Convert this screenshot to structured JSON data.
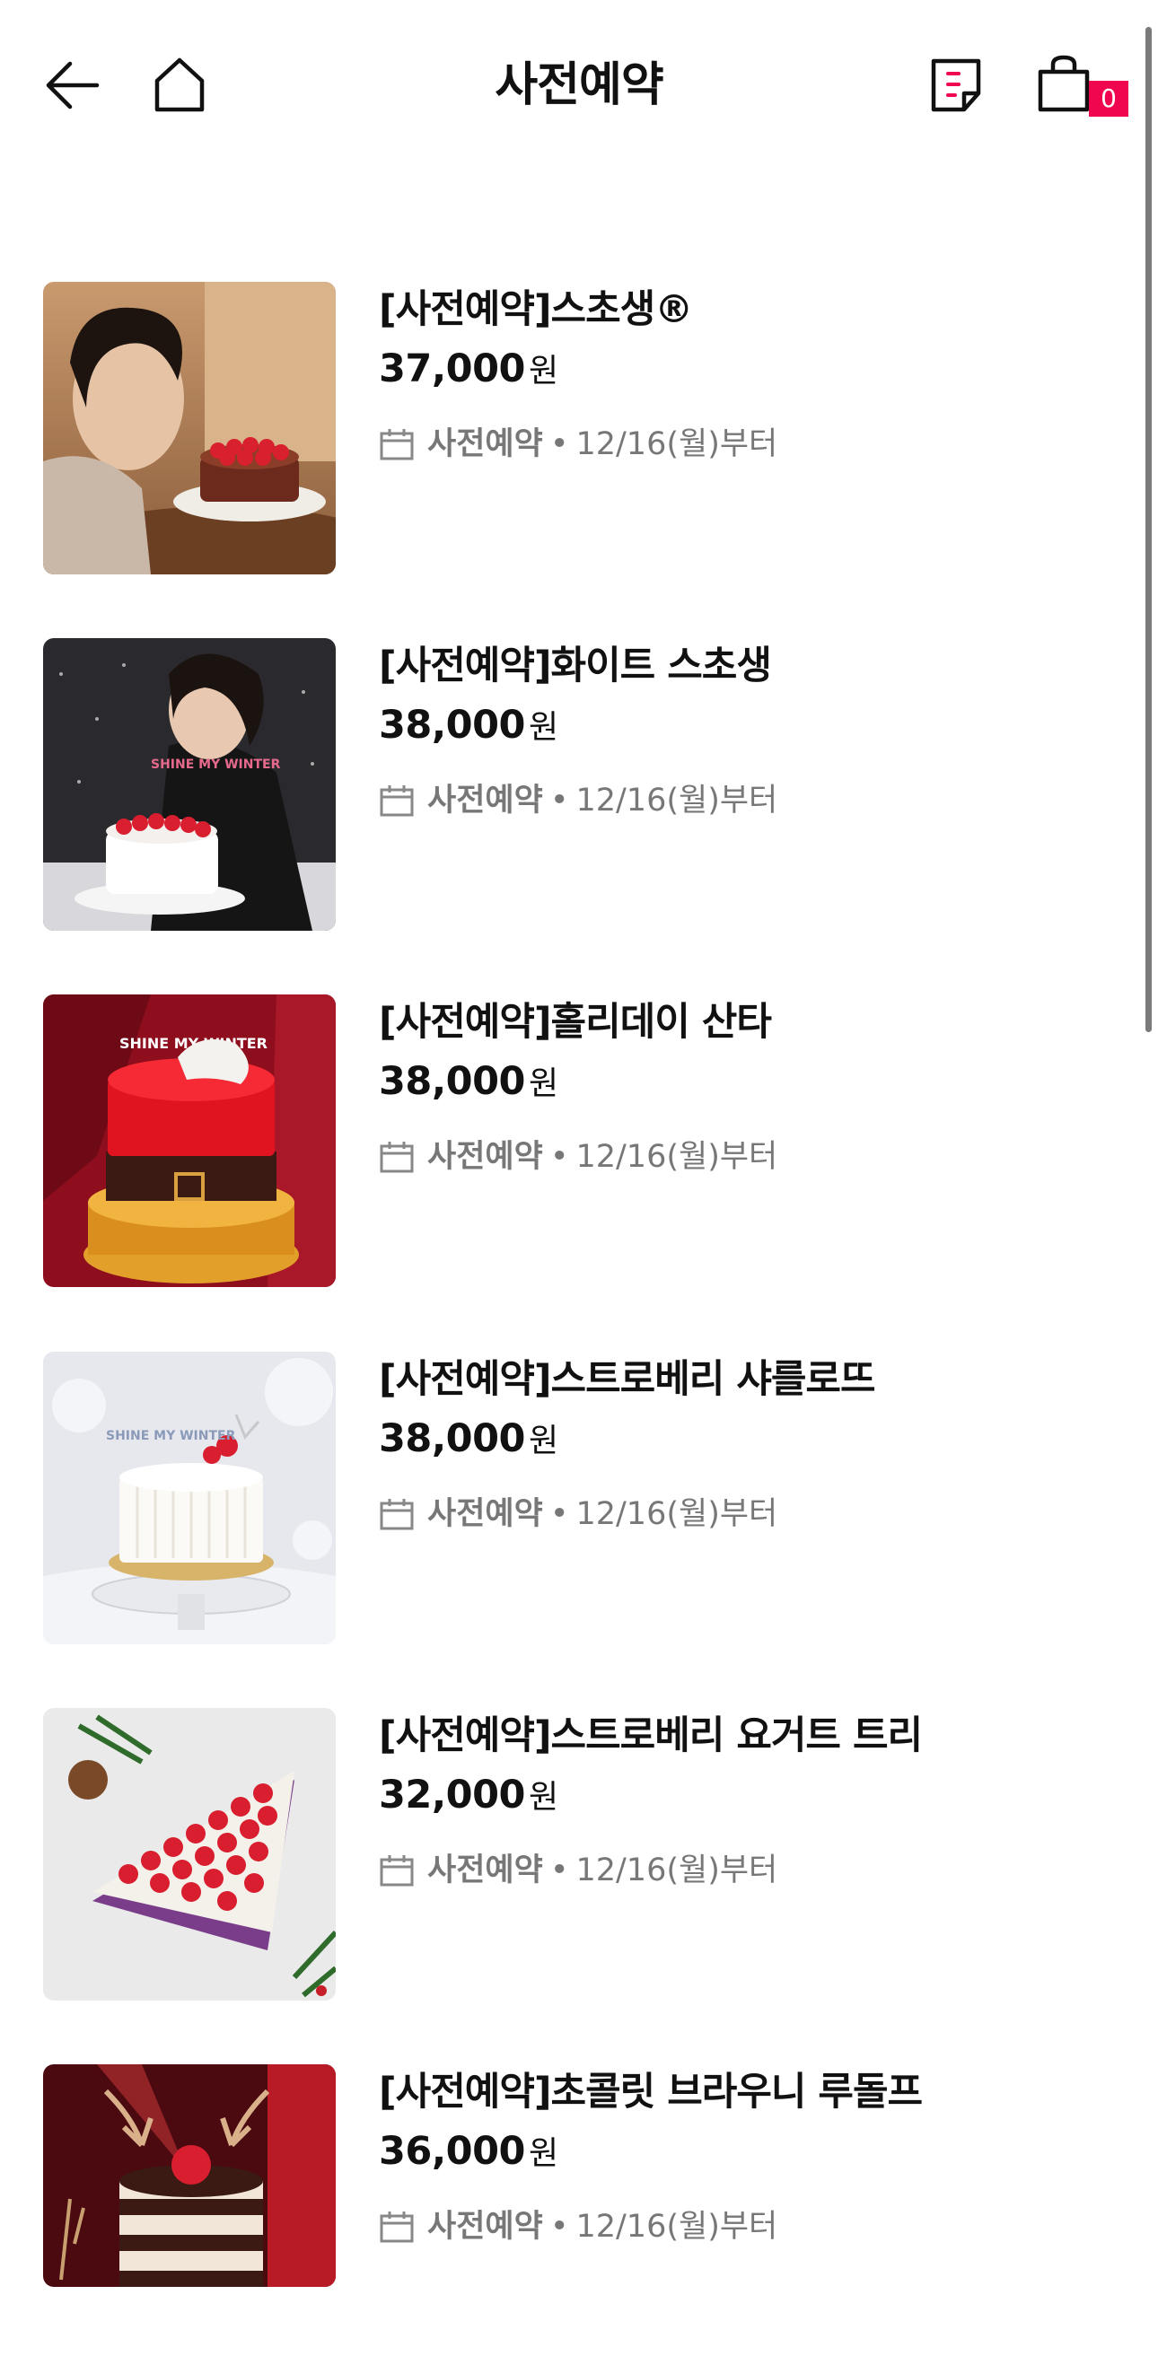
{
  "header": {
    "title": "사전예약",
    "cart_count": "0"
  },
  "colors": {
    "accent": "#f0064f",
    "text": "#111111",
    "muted": "#777777"
  },
  "icons": [
    "back-arrow-icon",
    "home-icon",
    "order-list-icon",
    "shopping-bag-icon",
    "calendar-icon"
  ],
  "products": [
    {
      "name": "[사전예약]스초생®",
      "price": "37,000",
      "unit": "원",
      "tag": "사전예약",
      "date": "12/16(월)부터"
    },
    {
      "name": "[사전예약]화이트 스초생",
      "price": "38,000",
      "unit": "원",
      "tag": "사전예약",
      "date": "12/16(월)부터"
    },
    {
      "name": "[사전예약]홀리데이 산타",
      "price": "38,000",
      "unit": "원",
      "tag": "사전예약",
      "date": "12/16(월)부터"
    },
    {
      "name": "[사전예약]스트로베리 샤를로뜨",
      "price": "38,000",
      "unit": "원",
      "tag": "사전예약",
      "date": "12/16(월)부터"
    },
    {
      "name": "[사전예약]스트로베리 요거트 트리",
      "price": "32,000",
      "unit": "원",
      "tag": "사전예약",
      "date": "12/16(월)부터"
    },
    {
      "name": "[사전예약]초콜릿 브라우니 루돌프",
      "price": "36,000",
      "unit": "원",
      "tag": "사전예약",
      "date": "12/16(월)부터"
    }
  ],
  "image_texts": {
    "shine_my_winter": "SHINE MY WINTER"
  }
}
